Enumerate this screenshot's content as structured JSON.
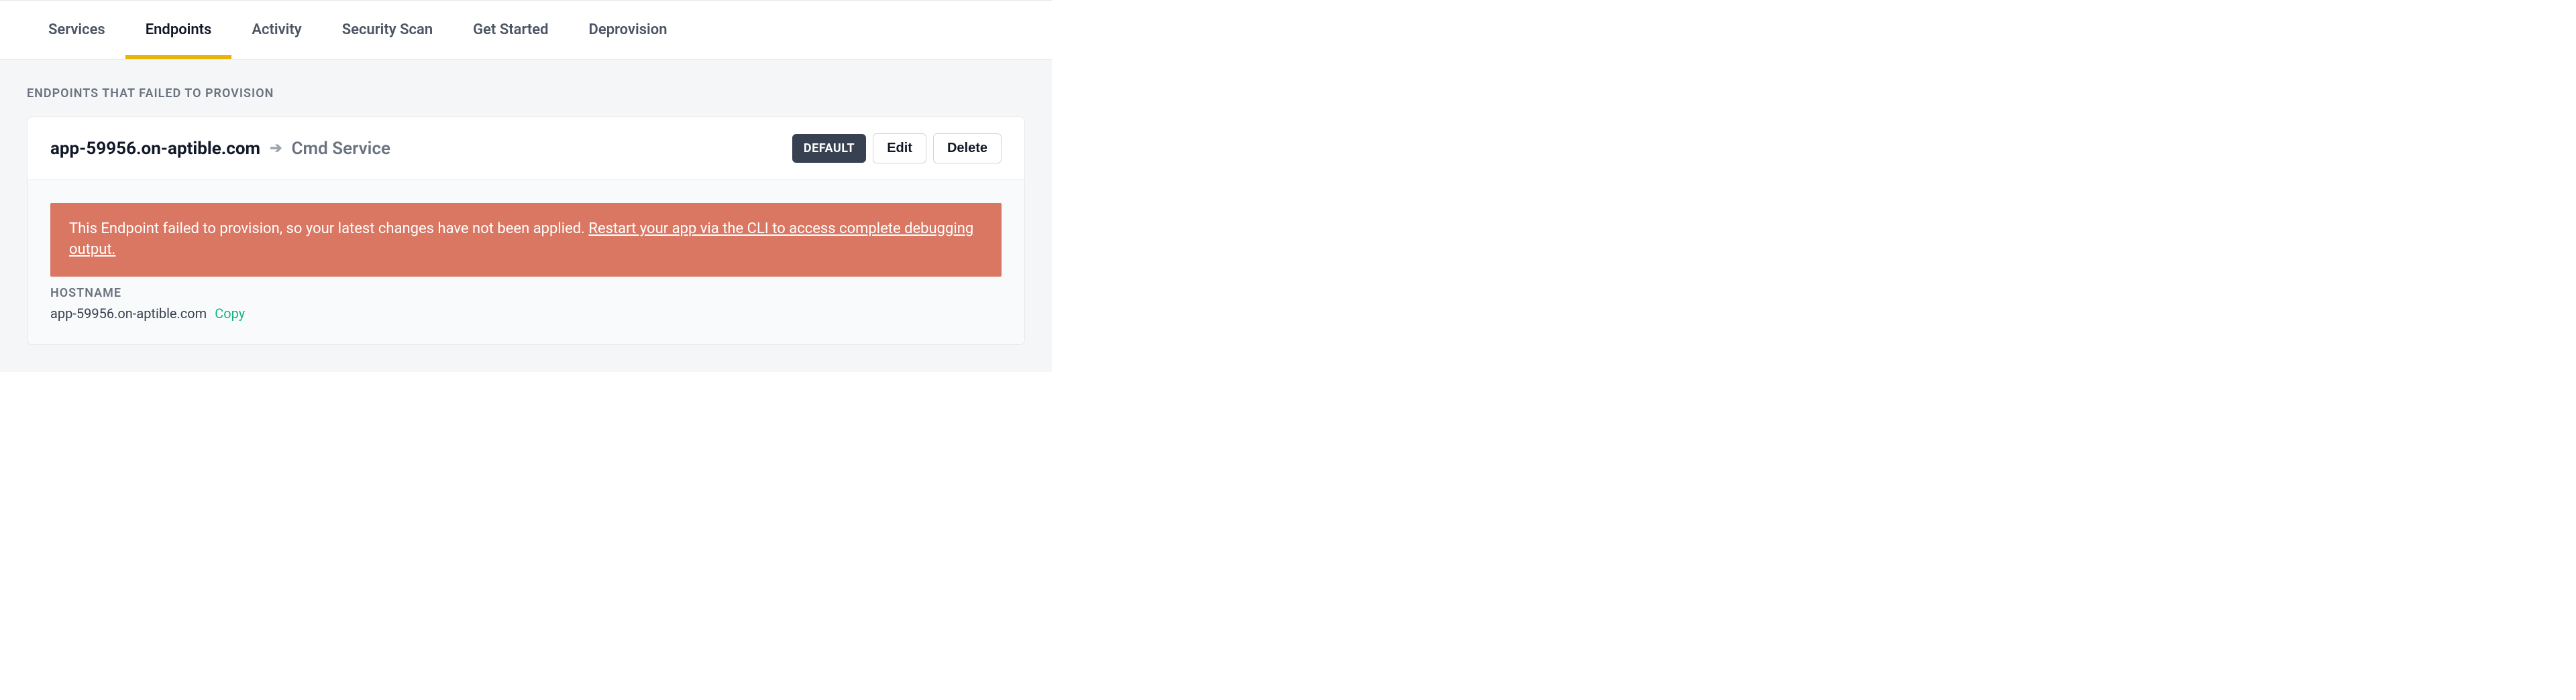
{
  "tabs": [
    {
      "label": "Services"
    },
    {
      "label": "Endpoints"
    },
    {
      "label": "Activity"
    },
    {
      "label": "Security Scan"
    },
    {
      "label": "Get Started"
    },
    {
      "label": "Deprovision"
    }
  ],
  "section_title": "ENDPOINTS THAT FAILED TO PROVISION",
  "endpoint": {
    "host": "app-59956.on-aptible.com",
    "service": "Cmd Service",
    "badge": "DEFAULT",
    "edit_label": "Edit",
    "delete_label": "Delete",
    "alert_text": "This Endpoint failed to provision, so your latest changes have not been applied. ",
    "alert_link": "Restart your app via the CLI to access complete debugging output.",
    "hostname_label": "HOSTNAME",
    "hostname_value": "app-59956.on-aptible.com",
    "copy_label": "Copy"
  }
}
